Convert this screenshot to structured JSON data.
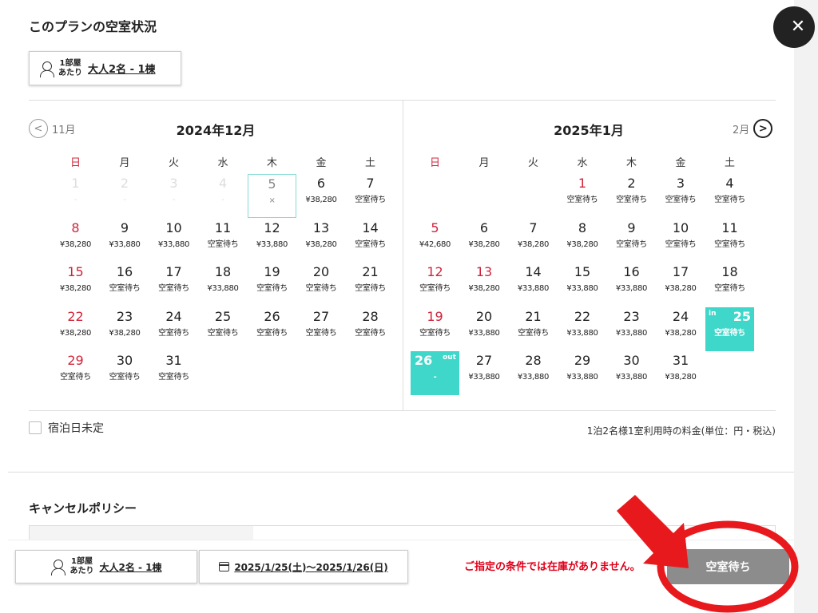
{
  "header": {
    "title": "このプランの空室状況",
    "room_label_line1": "1部屋",
    "room_label_line2": "あたり",
    "guests": "大人2名 - 1棟"
  },
  "calendar": {
    "prev_label": "11月",
    "next_label": "2月",
    "weekdays": [
      "日",
      "月",
      "火",
      "水",
      "木",
      "金",
      "土"
    ],
    "months": [
      {
        "title": "2024年12月",
        "rows": [
          [
            [
              "1",
              "-",
              "past"
            ],
            [
              "2",
              "-",
              "past"
            ],
            [
              "3",
              "-",
              "past"
            ],
            [
              "4",
              "-",
              "past"
            ],
            [
              "5",
              "×",
              "today"
            ],
            [
              "6",
              "¥38,280",
              ""
            ],
            [
              "7",
              "空室待ち",
              ""
            ]
          ],
          [
            [
              "8",
              "¥38,280",
              ""
            ],
            [
              "9",
              "¥33,880",
              ""
            ],
            [
              "10",
              "¥33,880",
              ""
            ],
            [
              "11",
              "空室待ち",
              ""
            ],
            [
              "12",
              "¥33,880",
              ""
            ],
            [
              "13",
              "¥38,280",
              ""
            ],
            [
              "14",
              "空室待ち",
              ""
            ]
          ],
          [
            [
              "15",
              "¥38,280",
              ""
            ],
            [
              "16",
              "空室待ち",
              ""
            ],
            [
              "17",
              "空室待ち",
              ""
            ],
            [
              "18",
              "¥33,880",
              ""
            ],
            [
              "19",
              "空室待ち",
              ""
            ],
            [
              "20",
              "空室待ち",
              ""
            ],
            [
              "21",
              "空室待ち",
              ""
            ]
          ],
          [
            [
              "22",
              "¥38,280",
              ""
            ],
            [
              "23",
              "¥38,280",
              ""
            ],
            [
              "24",
              "空室待ち",
              ""
            ],
            [
              "25",
              "空室待ち",
              ""
            ],
            [
              "26",
              "空室待ち",
              ""
            ],
            [
              "27",
              "空室待ち",
              ""
            ],
            [
              "28",
              "空室待ち",
              ""
            ]
          ],
          [
            [
              "29",
              "空室待ち",
              ""
            ],
            [
              "30",
              "空室待ち",
              ""
            ],
            [
              "31",
              "空室待ち",
              ""
            ]
          ]
        ]
      },
      {
        "title": "2025年1月",
        "rows": [
          [
            [
              "",
              "",
              ""
            ],
            [
              "",
              "",
              ""
            ],
            [
              "",
              "",
              ""
            ],
            [
              "1",
              "空室待ち",
              "holiday"
            ],
            [
              "2",
              "空室待ち",
              ""
            ],
            [
              "3",
              "空室待ち",
              ""
            ],
            [
              "4",
              "空室待ち",
              ""
            ]
          ],
          [
            [
              "5",
              "¥42,680",
              ""
            ],
            [
              "6",
              "¥38,280",
              ""
            ],
            [
              "7",
              "¥38,280",
              ""
            ],
            [
              "8",
              "¥38,280",
              ""
            ],
            [
              "9",
              "空室待ち",
              ""
            ],
            [
              "10",
              "空室待ち",
              ""
            ],
            [
              "11",
              "空室待ち",
              ""
            ]
          ],
          [
            [
              "12",
              "空室待ち",
              ""
            ],
            [
              "13",
              "¥38,280",
              "holiday"
            ],
            [
              "14",
              "¥33,880",
              ""
            ],
            [
              "15",
              "¥33,880",
              ""
            ],
            [
              "16",
              "¥33,880",
              ""
            ],
            [
              "17",
              "¥38,280",
              ""
            ],
            [
              "18",
              "空室待ち",
              ""
            ]
          ],
          [
            [
              "19",
              "空室待ち",
              ""
            ],
            [
              "20",
              "¥33,880",
              ""
            ],
            [
              "21",
              "空室待ち",
              ""
            ],
            [
              "22",
              "¥33,880",
              ""
            ],
            [
              "23",
              "¥33,880",
              ""
            ],
            [
              "24",
              "¥38,280",
              ""
            ],
            [
              "25",
              "空室待ち",
              "sel-in"
            ]
          ],
          [
            [
              "26",
              "-",
              "sel-out"
            ],
            [
              "27",
              "¥33,880",
              ""
            ],
            [
              "28",
              "¥33,880",
              ""
            ],
            [
              "29",
              "¥33,880",
              ""
            ],
            [
              "30",
              "¥33,880",
              ""
            ],
            [
              "31",
              "¥38,280",
              ""
            ]
          ]
        ]
      }
    ],
    "checkin_tag": "in",
    "checkout_tag": "out",
    "undecided_label": "宿泊日未定",
    "price_note": "1泊2名様1室利用時の料金(単位：円・税込)"
  },
  "cancel_policy": {
    "title": "キャンセルポリシー"
  },
  "bottom_bar": {
    "room_label_line1": "1部屋",
    "room_label_line2": "あたり",
    "guests": "大人2名 - 1棟",
    "dates": "2025/1/25(土)〜2025/1/26(日)",
    "warning": "ご指定の条件では在庫がありません。",
    "waitlist_button": "空室待ち"
  },
  "colors": {
    "selected": "#3fd7c9",
    "sunday": "#d0243a",
    "warning": "#e0001a",
    "annotation": "#e8191d"
  },
  "icons": [
    "close-icon",
    "person-icon",
    "chevron-left-icon",
    "chevron-right-icon",
    "calendar-icon",
    "checkbox-icon",
    "arrow-annotation",
    "circle-annotation"
  ]
}
